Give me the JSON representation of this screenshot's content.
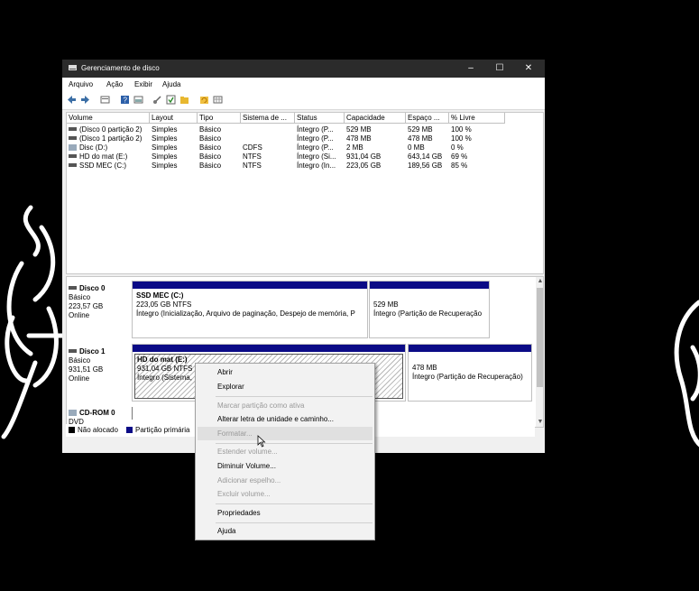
{
  "window": {
    "title": "Gerenciamento de disco",
    "min_glyph": "–",
    "max_glyph": "☐",
    "close_glyph": "✕"
  },
  "menubar": [
    "Arquivo",
    "Ação",
    "Exibir",
    "Ajuda"
  ],
  "toolbar_icons": [
    "back-arrow-icon",
    "forward-arrow-icon",
    "disk-list-icon",
    "help-icon",
    "properties-icon",
    "connect-icon",
    "check-icon",
    "folder-icon",
    "refresh-icon",
    "grid-icon"
  ],
  "volumes": {
    "headers": [
      "Volume",
      "Layout",
      "Tipo",
      "Sistema de ...",
      "Status",
      "Capacidade",
      "Espaço ...",
      "% Livre"
    ],
    "rows": [
      [
        "(Disco 0 partição 2)",
        "Simples",
        "Básico",
        "",
        "Íntegro (P...",
        "529 MB",
        "529 MB",
        "100 %"
      ],
      [
        "(Disco 1 partição 2)",
        "Simples",
        "Básico",
        "",
        "Íntegro (P...",
        "478 MB",
        "478 MB",
        "100 %"
      ],
      [
        "Disc (D:)",
        "Simples",
        "Básico",
        "CDFS",
        "Íntegro (P...",
        "2 MB",
        "0 MB",
        "0 %"
      ],
      [
        "HD do mat (E:)",
        "Simples",
        "Básico",
        "NTFS",
        "Íntegro (Si...",
        "931,04 GB",
        "643,14 GB",
        "69 %"
      ],
      [
        "SSD MEC (C:)",
        "Simples",
        "Básico",
        "NTFS",
        "Íntegro (In...",
        "223,05 GB",
        "189,56 GB",
        "85 %"
      ]
    ]
  },
  "disks": [
    {
      "name": "Disco 0",
      "type": "Básico",
      "size": "223,57 GB",
      "state": "Online",
      "partitions": [
        {
          "name": "SSD MEC  (C:)",
          "size": "223,05 GB NTFS",
          "status": "Íntegro (Inicialização, Arquivo de paginação, Despejo de memória, P"
        },
        {
          "name": "",
          "size": "529 MB",
          "status": "Íntegro (Partição de Recuperação"
        }
      ]
    },
    {
      "name": "Disco 1",
      "type": "Básico",
      "size": "931,51 GB",
      "state": "Online",
      "partitions": [
        {
          "name": "HD do mat  (E:)",
          "size": "931,04 GB NTFS",
          "status": "Íntegro (Sistema,"
        },
        {
          "name": "",
          "size": "478 MB",
          "status": "Íntegro (Partição de Recuperação)"
        }
      ]
    },
    {
      "name": "CD-ROM 0",
      "type": "DVD"
    }
  ],
  "legend": {
    "unallocated": "Não alocado",
    "primary": "Partição primária",
    "unallocated_color": "#000000",
    "primary_color": "#0b0b86"
  },
  "context_menu": {
    "items": [
      {
        "label": "Abrir",
        "enabled": true
      },
      {
        "label": "Explorar",
        "enabled": true
      },
      {
        "label": "Marcar partição como ativa",
        "enabled": false
      },
      {
        "label": "Alterar letra de unidade e caminho...",
        "enabled": true
      },
      {
        "label": "Formatar...",
        "enabled": false,
        "hovered": true
      },
      {
        "label": "Estender volume...",
        "enabled": false
      },
      {
        "label": "Diminuir Volume...",
        "enabled": true
      },
      {
        "label": "Adicionar espelho...",
        "enabled": false
      },
      {
        "label": "Excluir volume...",
        "enabled": false
      },
      {
        "label": "Propriedades",
        "enabled": true
      },
      {
        "label": "Ajuda",
        "enabled": true
      }
    ]
  },
  "colors": {
    "titlebar": "#2b2b2b",
    "partition_bar": "#0b0b86",
    "background": "#000000"
  }
}
